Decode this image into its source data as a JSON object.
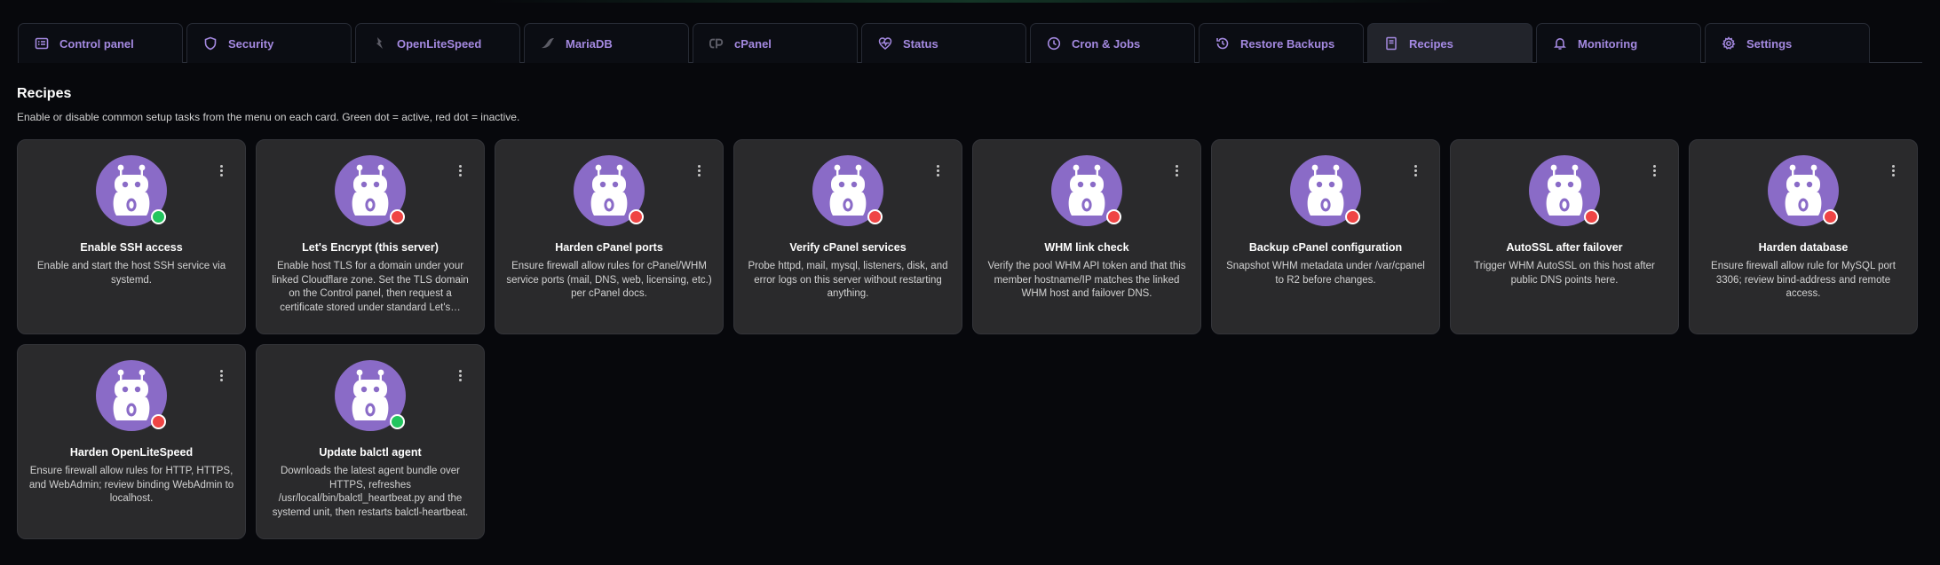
{
  "tabs": [
    {
      "label": "Control panel",
      "icon": "control-panel-icon",
      "active": false
    },
    {
      "label": "Security",
      "icon": "shield-icon",
      "active": false
    },
    {
      "label": "OpenLiteSpeed",
      "icon": "openlitespeed-icon",
      "active": false
    },
    {
      "label": "MariaDB",
      "icon": "mariadb-icon",
      "active": false
    },
    {
      "label": "cPanel",
      "icon": "cpanel-icon",
      "active": false
    },
    {
      "label": "Status",
      "icon": "heart-pulse-icon",
      "active": false
    },
    {
      "label": "Cron & Jobs",
      "icon": "clock-icon",
      "active": false
    },
    {
      "label": "Restore Backups",
      "icon": "history-icon",
      "active": false
    },
    {
      "label": "Recipes",
      "icon": "book-icon",
      "active": true
    },
    {
      "label": "Monitoring",
      "icon": "bell-icon",
      "active": false
    },
    {
      "label": "Settings",
      "icon": "gear-icon",
      "active": false
    }
  ],
  "page": {
    "title": "Recipes",
    "subtitle": "Enable or disable common setup tasks from the menu on each card. Green dot = active, red dot = inactive."
  },
  "colors": {
    "accent": "#a489e0",
    "avatar": "#8a6bc7",
    "active": "#22c55e",
    "inactive": "#ef4444"
  },
  "recipes": [
    {
      "title": "Enable SSH access",
      "description": "Enable and start the host SSH service via systemd.",
      "status": "active"
    },
    {
      "title": "Let's Encrypt (this server)",
      "description": "Enable host TLS for a domain under your linked Cloudflare zone. Set the TLS domain on the Control panel, then request a certificate stored under standard Let's…",
      "status": "inactive"
    },
    {
      "title": "Harden cPanel ports",
      "description": "Ensure firewall allow rules for cPanel/WHM service ports (mail, DNS, web, licensing, etc.) per cPanel docs.",
      "status": "inactive"
    },
    {
      "title": "Verify cPanel services",
      "description": "Probe httpd, mail, mysql, listeners, disk, and error logs on this server without restarting anything.",
      "status": "inactive"
    },
    {
      "title": "WHM link check",
      "description": "Verify the pool WHM API token and that this member hostname/IP matches the linked WHM host and failover DNS.",
      "status": "inactive"
    },
    {
      "title": "Backup cPanel configuration",
      "description": "Snapshot WHM metadata under /var/cpanel to R2 before changes.",
      "status": "inactive"
    },
    {
      "title": "AutoSSL after failover",
      "description": "Trigger WHM AutoSSL on this host after public DNS points here.",
      "status": "inactive"
    },
    {
      "title": "Harden database",
      "description": "Ensure firewall allow rule for MySQL port 3306; review bind-address and remote access.",
      "status": "inactive"
    },
    {
      "title": "Harden OpenLiteSpeed",
      "description": "Ensure firewall allow rules for HTTP, HTTPS, and WebAdmin; review binding WebAdmin to localhost.",
      "status": "inactive"
    },
    {
      "title": "Update balctl agent",
      "description": "Downloads the latest agent bundle over HTTPS, refreshes /usr/local/bin/balctl_heartbeat.py and the systemd unit, then restarts balctl-heartbeat.",
      "status": "active"
    }
  ]
}
